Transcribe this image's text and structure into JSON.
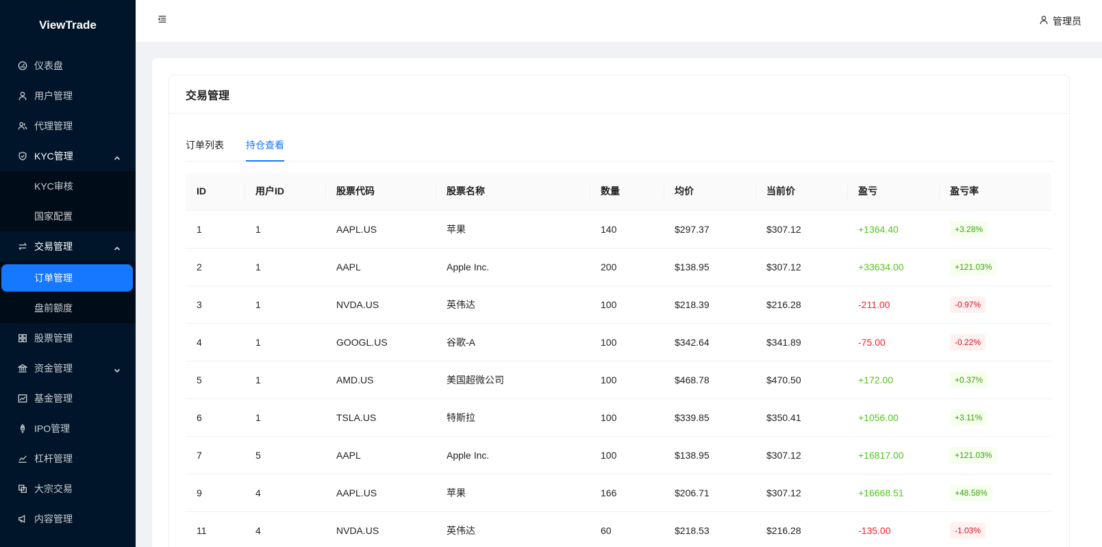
{
  "brand": "ViewTrade",
  "header": {
    "user_name": "管理员"
  },
  "sidebar": {
    "items": [
      {
        "label": "仪表盘",
        "icon": "dashboard-icon"
      },
      {
        "label": "用户管理",
        "icon": "user-icon"
      },
      {
        "label": "代理管理",
        "icon": "agent-icon"
      },
      {
        "label": "KYC管理",
        "icon": "shield-check-icon",
        "expanded": true,
        "children": [
          "KYC审核",
          "国家配置"
        ]
      },
      {
        "label": "交易管理",
        "icon": "swap-icon",
        "expanded": true,
        "children": [
          "订单管理",
          "盘前额度"
        ],
        "active_child": "订单管理"
      },
      {
        "label": "股票管理",
        "icon": "grid-icon"
      },
      {
        "label": "资金管理",
        "icon": "bank-icon",
        "expanded": false
      },
      {
        "label": "基金管理",
        "icon": "fund-chart-icon"
      },
      {
        "label": "IPO管理",
        "icon": "rocket-icon"
      },
      {
        "label": "杠杆管理",
        "icon": "line-chart-icon"
      },
      {
        "label": "大宗交易",
        "icon": "block-icon"
      },
      {
        "label": "内容管理",
        "icon": "notification-icon"
      }
    ]
  },
  "page": {
    "title": "交易管理",
    "tabs": [
      {
        "label": "订单列表",
        "active": false
      },
      {
        "label": "持仓查看",
        "active": true
      }
    ]
  },
  "table": {
    "columns": [
      "ID",
      "用户ID",
      "股票代码",
      "股票名称",
      "数量",
      "均价",
      "当前价",
      "盈亏",
      "盈亏率"
    ],
    "rows": [
      {
        "id": "1",
        "user_id": "1",
        "code": "AAPL.US",
        "name": "苹果",
        "qty": "140",
        "avg": "$297.37",
        "cur": "$307.12",
        "pnl": "+1364.40",
        "rate": "+3.28%",
        "dir": "pos"
      },
      {
        "id": "2",
        "user_id": "1",
        "code": "AAPL",
        "name": "Apple Inc.",
        "qty": "200",
        "avg": "$138.95",
        "cur": "$307.12",
        "pnl": "+33634.00",
        "rate": "+121.03%",
        "dir": "pos"
      },
      {
        "id": "3",
        "user_id": "1",
        "code": "NVDA.US",
        "name": "英伟达",
        "qty": "100",
        "avg": "$218.39",
        "cur": "$216.28",
        "pnl": "-211.00",
        "rate": "-0.97%",
        "dir": "neg"
      },
      {
        "id": "4",
        "user_id": "1",
        "code": "GOOGL.US",
        "name": "谷歌-A",
        "qty": "100",
        "avg": "$342.64",
        "cur": "$341.89",
        "pnl": "-75.00",
        "rate": "-0.22%",
        "dir": "neg"
      },
      {
        "id": "5",
        "user_id": "1",
        "code": "AMD.US",
        "name": "美国超微公司",
        "qty": "100",
        "avg": "$468.78",
        "cur": "$470.50",
        "pnl": "+172.00",
        "rate": "+0.37%",
        "dir": "pos"
      },
      {
        "id": "6",
        "user_id": "1",
        "code": "TSLA.US",
        "name": "特斯拉",
        "qty": "100",
        "avg": "$339.85",
        "cur": "$350.41",
        "pnl": "+1056.00",
        "rate": "+3.11%",
        "dir": "pos"
      },
      {
        "id": "7",
        "user_id": "5",
        "code": "AAPL",
        "name": "Apple Inc.",
        "qty": "100",
        "avg": "$138.95",
        "cur": "$307.12",
        "pnl": "+16817.00",
        "rate": "+121.03%",
        "dir": "pos"
      },
      {
        "id": "9",
        "user_id": "4",
        "code": "AAPL.US",
        "name": "苹果",
        "qty": "166",
        "avg": "$206.71",
        "cur": "$307.12",
        "pnl": "+16668.51",
        "rate": "+48.58%",
        "dir": "pos"
      },
      {
        "id": "11",
        "user_id": "4",
        "code": "NVDA.US",
        "name": "英伟达",
        "qty": "60",
        "avg": "$218.53",
        "cur": "$216.28",
        "pnl": "-135.00",
        "rate": "-1.03%",
        "dir": "neg"
      }
    ]
  },
  "colors": {
    "sidebar_bg": "#001529",
    "accent": "#1677ff",
    "positive": "#52c41a",
    "negative": "#f5222d"
  }
}
